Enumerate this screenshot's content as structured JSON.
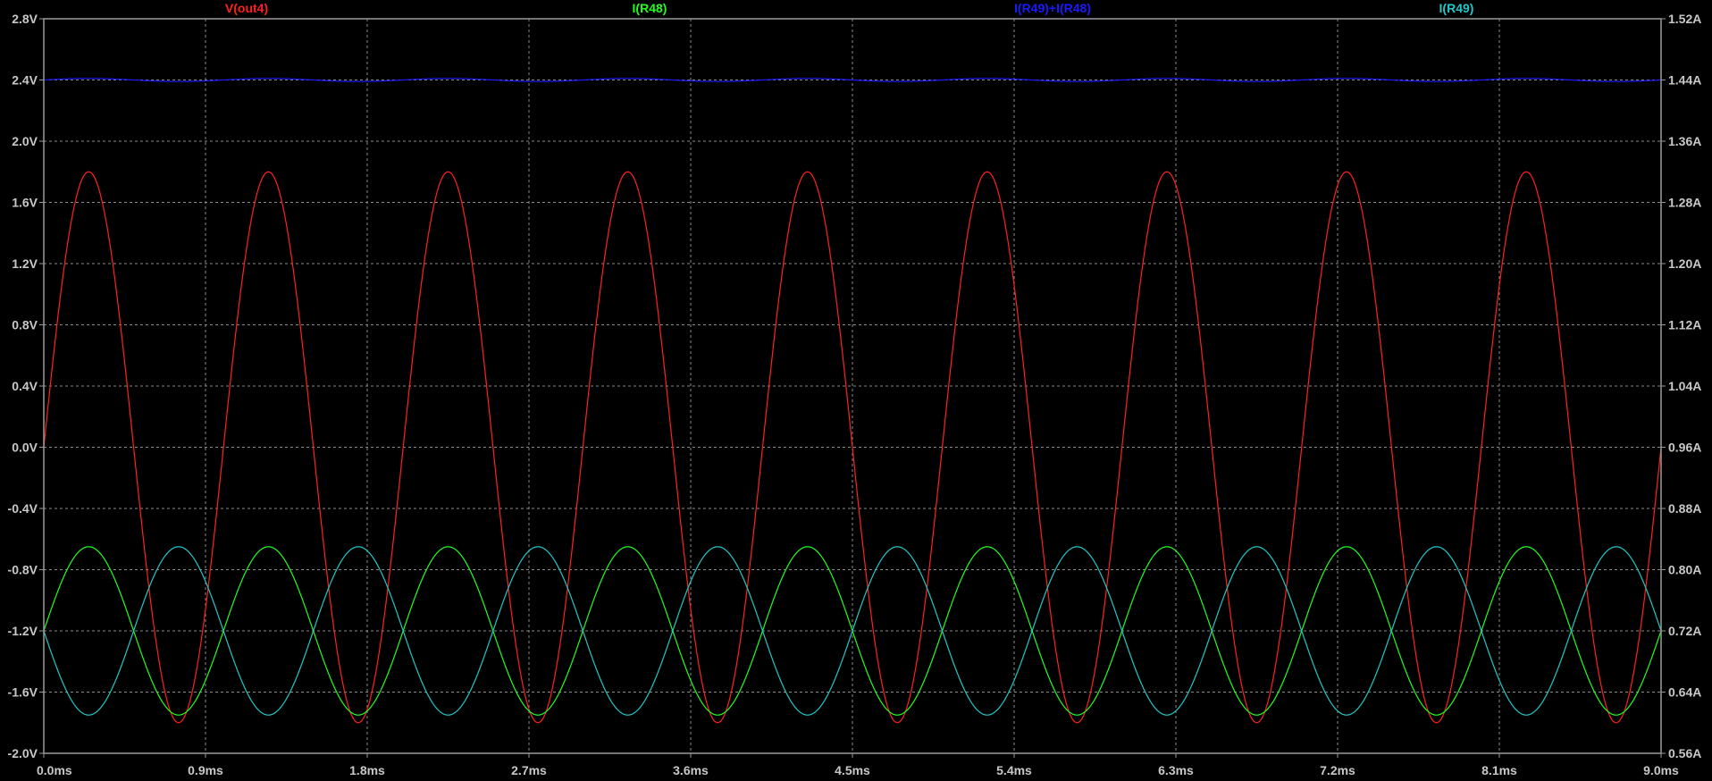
{
  "chart_data": {
    "type": "line",
    "title": "",
    "xlabel": "",
    "ylabel_left": "",
    "ylabel_right": "",
    "grid": true,
    "background": "#000000",
    "grid_color": "#8a8a8a",
    "axis_color": "#9a9a9a",
    "tick_color": "#c8c8c8",
    "x_axis": {
      "unit": "ms",
      "range": [
        0.0,
        9.0
      ],
      "ticks": [
        0.0,
        0.9,
        1.8,
        2.7,
        3.6,
        4.5,
        5.4,
        6.3,
        7.2,
        8.1,
        9.0
      ],
      "tick_labels": [
        "0.0ms",
        "0.9ms",
        "1.8ms",
        "2.7ms",
        "3.6ms",
        "4.5ms",
        "5.4ms",
        "6.3ms",
        "7.2ms",
        "8.1ms",
        "9.0ms"
      ]
    },
    "y_left": {
      "unit": "V",
      "range": [
        -2.0,
        2.8
      ],
      "ticks": [
        2.8,
        2.4,
        2.0,
        1.6,
        1.2,
        0.8,
        0.4,
        0.0,
        -0.4,
        -0.8,
        -1.2,
        -1.6,
        -2.0
      ],
      "tick_labels": [
        "2.8V",
        "2.4V",
        "2.0V",
        "1.6V",
        "1.2V",
        "0.8V",
        "0.4V",
        "0.0V",
        "-0.4V",
        "-0.8V",
        "-1.2V",
        "-1.6V",
        "-2.0V"
      ]
    },
    "y_right": {
      "unit": "A",
      "range": [
        0.56,
        1.52
      ],
      "ticks": [
        1.52,
        1.44,
        1.36,
        1.28,
        1.2,
        1.12,
        1.04,
        0.96,
        0.88,
        0.8,
        0.72,
        0.64,
        0.56
      ],
      "tick_labels": [
        "1.52A",
        "1.44A",
        "1.36A",
        "1.28A",
        "1.20A",
        "1.12A",
        "1.04A",
        "0.96A",
        "0.88A",
        "0.80A",
        "0.72A",
        "0.64A",
        "0.56A"
      ]
    },
    "series": [
      {
        "name": "V(out4)",
        "axis": "left",
        "color": "#ff2020",
        "model": "sine",
        "offset": 0.0,
        "amplitude": 1.8,
        "frequency_khz": 1.0,
        "phase_deg": 0
      },
      {
        "name": "I(R48)",
        "axis": "right",
        "color": "#20ff20",
        "model": "sine",
        "offset": 0.72,
        "amplitude": 0.11,
        "frequency_khz": 1.0,
        "phase_deg": 0
      },
      {
        "name": "I(R49)+I(R48)",
        "axis": "right",
        "color": "#1a1aff",
        "model": "sine",
        "offset": 1.44,
        "amplitude": 0.002,
        "frequency_khz": 1.0,
        "phase_deg": 0
      },
      {
        "name": "I(R49)",
        "axis": "right",
        "color": "#20c8c8",
        "model": "sine",
        "offset": 0.72,
        "amplitude": 0.11,
        "frequency_khz": 1.0,
        "phase_deg": 180
      }
    ]
  }
}
